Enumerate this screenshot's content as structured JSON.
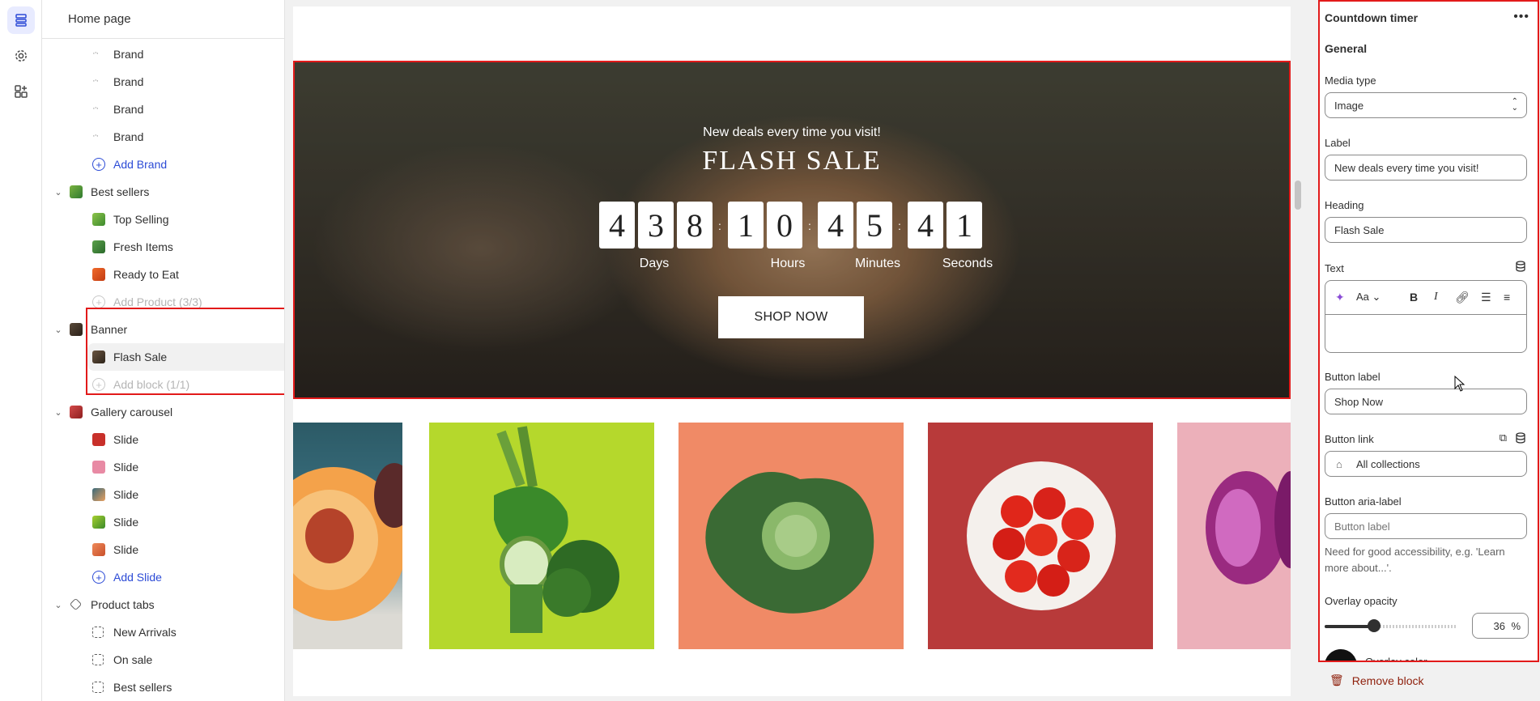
{
  "sidebar": {
    "title": "Home page",
    "brand_items": [
      "Brand",
      "Brand",
      "Brand",
      "Brand"
    ],
    "add_brand": "Add Brand",
    "best_sellers": {
      "label": "Best sellers",
      "children": [
        "Top Selling",
        "Fresh Items",
        "Ready to Eat"
      ],
      "add": "Add Product (3/3)"
    },
    "banner": {
      "label": "Banner",
      "children": [
        "Flash Sale"
      ],
      "add": "Add block (1/1)"
    },
    "gallery": {
      "label": "Gallery carousel",
      "children": [
        "Slide",
        "Slide",
        "Slide",
        "Slide",
        "Slide"
      ],
      "add": "Add Slide"
    },
    "product_tabs": {
      "label": "Product tabs",
      "children": [
        "New Arrivals",
        "On sale",
        "Best sellers"
      ]
    }
  },
  "preview": {
    "banner": {
      "label": "New deals every time you visit!",
      "heading": "FLASH SALE",
      "digits": {
        "days": [
          "4",
          "3",
          "8"
        ],
        "hours": [
          "1",
          "0"
        ],
        "minutes": [
          "4",
          "5"
        ],
        "seconds": [
          "4",
          "1"
        ]
      },
      "units": {
        "days": "Days",
        "hours": "Hours",
        "minutes": "Minutes",
        "seconds": "Seconds"
      },
      "button": "SHOP NOW"
    }
  },
  "panel": {
    "title": "Countdown timer",
    "section": "General",
    "media_type": {
      "label": "Media type",
      "value": "Image"
    },
    "label_field": {
      "label": "Label",
      "value": "New deals every time you visit!"
    },
    "heading_field": {
      "label": "Heading",
      "value": "Flash Sale"
    },
    "text_field": {
      "label": "Text"
    },
    "button_label": {
      "label": "Button label",
      "value": "Shop Now"
    },
    "button_link": {
      "label": "Button link",
      "value": "All collections"
    },
    "button_aria": {
      "label": "Button aria-label",
      "placeholder": "Button label",
      "hint": "Need for good accessibility, e.g. 'Learn more about...'."
    },
    "overlay_opacity": {
      "label": "Overlay opacity",
      "value": "36",
      "unit": "%",
      "fraction": 0.36
    },
    "overlay_color": {
      "label": "Overlay color"
    },
    "remove": "Remove block"
  },
  "colors": {
    "accent": "#2c4bd6",
    "highlight": "#e21a1a",
    "danger": "#8e1f0b"
  }
}
